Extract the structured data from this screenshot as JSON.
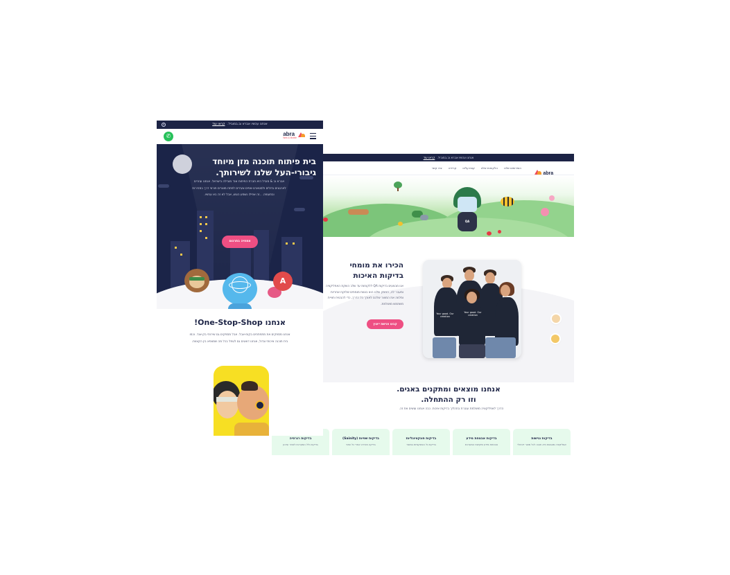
{
  "desktop": {
    "announcement": {
      "text": "אנחנו עכשיו אברא וב.במוביל.",
      "link": "קראו עוד"
    },
    "logo": {
      "name": "abra",
      "tagline": "Web & Mobile"
    },
    "nav_links": [
      "השירותים שלנו",
      "הלקוחות שלנו",
      "קצת עלינו",
      "קריירה",
      "צרו קשר"
    ],
    "hero_badge": "QA",
    "about": {
      "title_line1": "הכירו את מומחי",
      "title_line2": "בדיקות האיכות",
      "paragraph": "אנו מבצעים בדיקות QA ללקוחות עד שלב השקת האפליקציה ומעבר לה, החוזק שלנו הוא בצוות מומחים שלוקח אחריות ומלווה את המוצר שלכם לאורך כל הדרך, כדי להבטיח חוויית משתמש מושלמת.",
      "button": "קבעו פגישת ייעוץ"
    },
    "photo_shirts": [
      "Your good. Our creation",
      "Your good. Our creation"
    ],
    "bugs_section": {
      "title_line1": "אנחנו מוצאים ומתקנים באגים.",
      "title_line2": "וזו רק ההתחלה.",
      "subtitle": "הדרך לאפליקציה מושלמת עוברת בתהליך בדיקות איכות. כבה אנחנו עושים את זה."
    },
    "cards": [
      {
        "title": "בדיקות נגישות",
        "text": "אפליקציה מונגשת היא חובה לכל מוצר דיגיטלי"
      },
      {
        "title": "בדיקות אבטחת מידע",
        "text": "אבטחת מידע ותקינות המערכת"
      },
      {
        "title": "בדיקות פונקציונליות",
        "text": "בדיקת כל הפונקציות במוצר"
      },
      {
        "title": "בדיקות שפיות (Sainity)",
        "text": "בדיקה מהירה אחרי כל שינוי"
      },
      {
        "title": "בדיקות רגרסיה",
        "text": "בדיקת כלל המערכת לאחר עדכון"
      }
    ]
  },
  "mobile": {
    "announcement": {
      "text": "אנחנו עכשיו אברא וב.במוביל.",
      "link": "קראו עוד"
    },
    "logo": {
      "name": "abra",
      "tagline": "Web & Mobile"
    },
    "hero": {
      "title_line1": "בית פיתוח תוכנה מזן מיוחד",
      "title_line2": "גיבורי-העל שלנו לשירותך.",
      "paragraph": "אברא וב & מוביל היא חברת הפיתוח אנד מובילה בישראל. אנחנו עוזרים לארגונים גדולים ולסטארט-אפים צעירים לפתח מוצרים פורצי דרך במהירות ובתעופה. ..זה אפילו נשמע הוגש, אבל לא זה בא עכשיו.",
      "button": "צמחיה בתרגום"
    },
    "one_stop": {
      "title": "אנחנו One-Stop-Shop!",
      "paragraph": "אנחנו מספקים את מתפתחים בקוח-אבל. אבל מספקים גם שירותי בק-אנד. וכמו בית תוכנה איכותי וגדול, אנחנו דואגים גם לטפל בכל מה שמצפא בין הקצוות."
    }
  },
  "colors": {
    "navy": "#1c2345",
    "pink": "#ee4f83",
    "brand_red": "#ef4d5a",
    "brand_orange": "#f59b2b",
    "card_green": "#e6faec",
    "whatsapp": "#27c15a"
  },
  "icons": [
    "close-icon",
    "hamburger-menu-icon",
    "whatsapp-icon",
    "chat-widget-icon",
    "abra-logo-icon"
  ]
}
